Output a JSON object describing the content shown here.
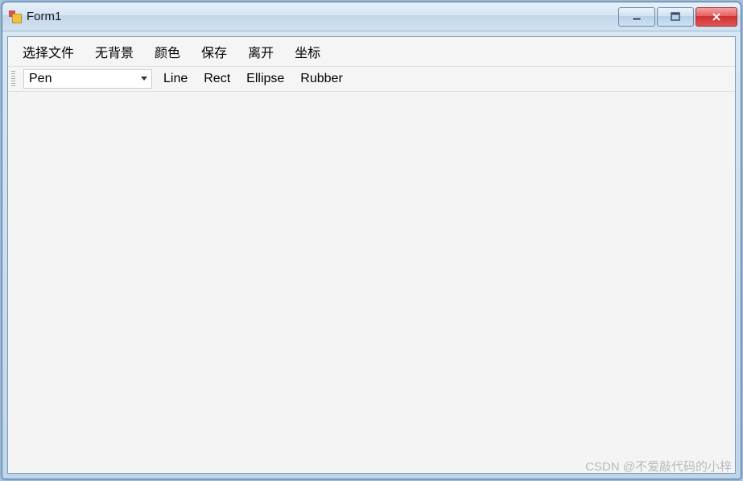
{
  "window": {
    "title": "Form1"
  },
  "menubar": {
    "items": [
      "选择文件",
      "无背景",
      "颜色",
      "保存",
      "离开",
      "坐标"
    ]
  },
  "toolbar": {
    "combo_value": "Pen",
    "buttons": [
      "Line",
      "Rect",
      "Ellipse",
      "Rubber"
    ]
  },
  "watermark": "CSDN @不爱敲代码的小梓"
}
